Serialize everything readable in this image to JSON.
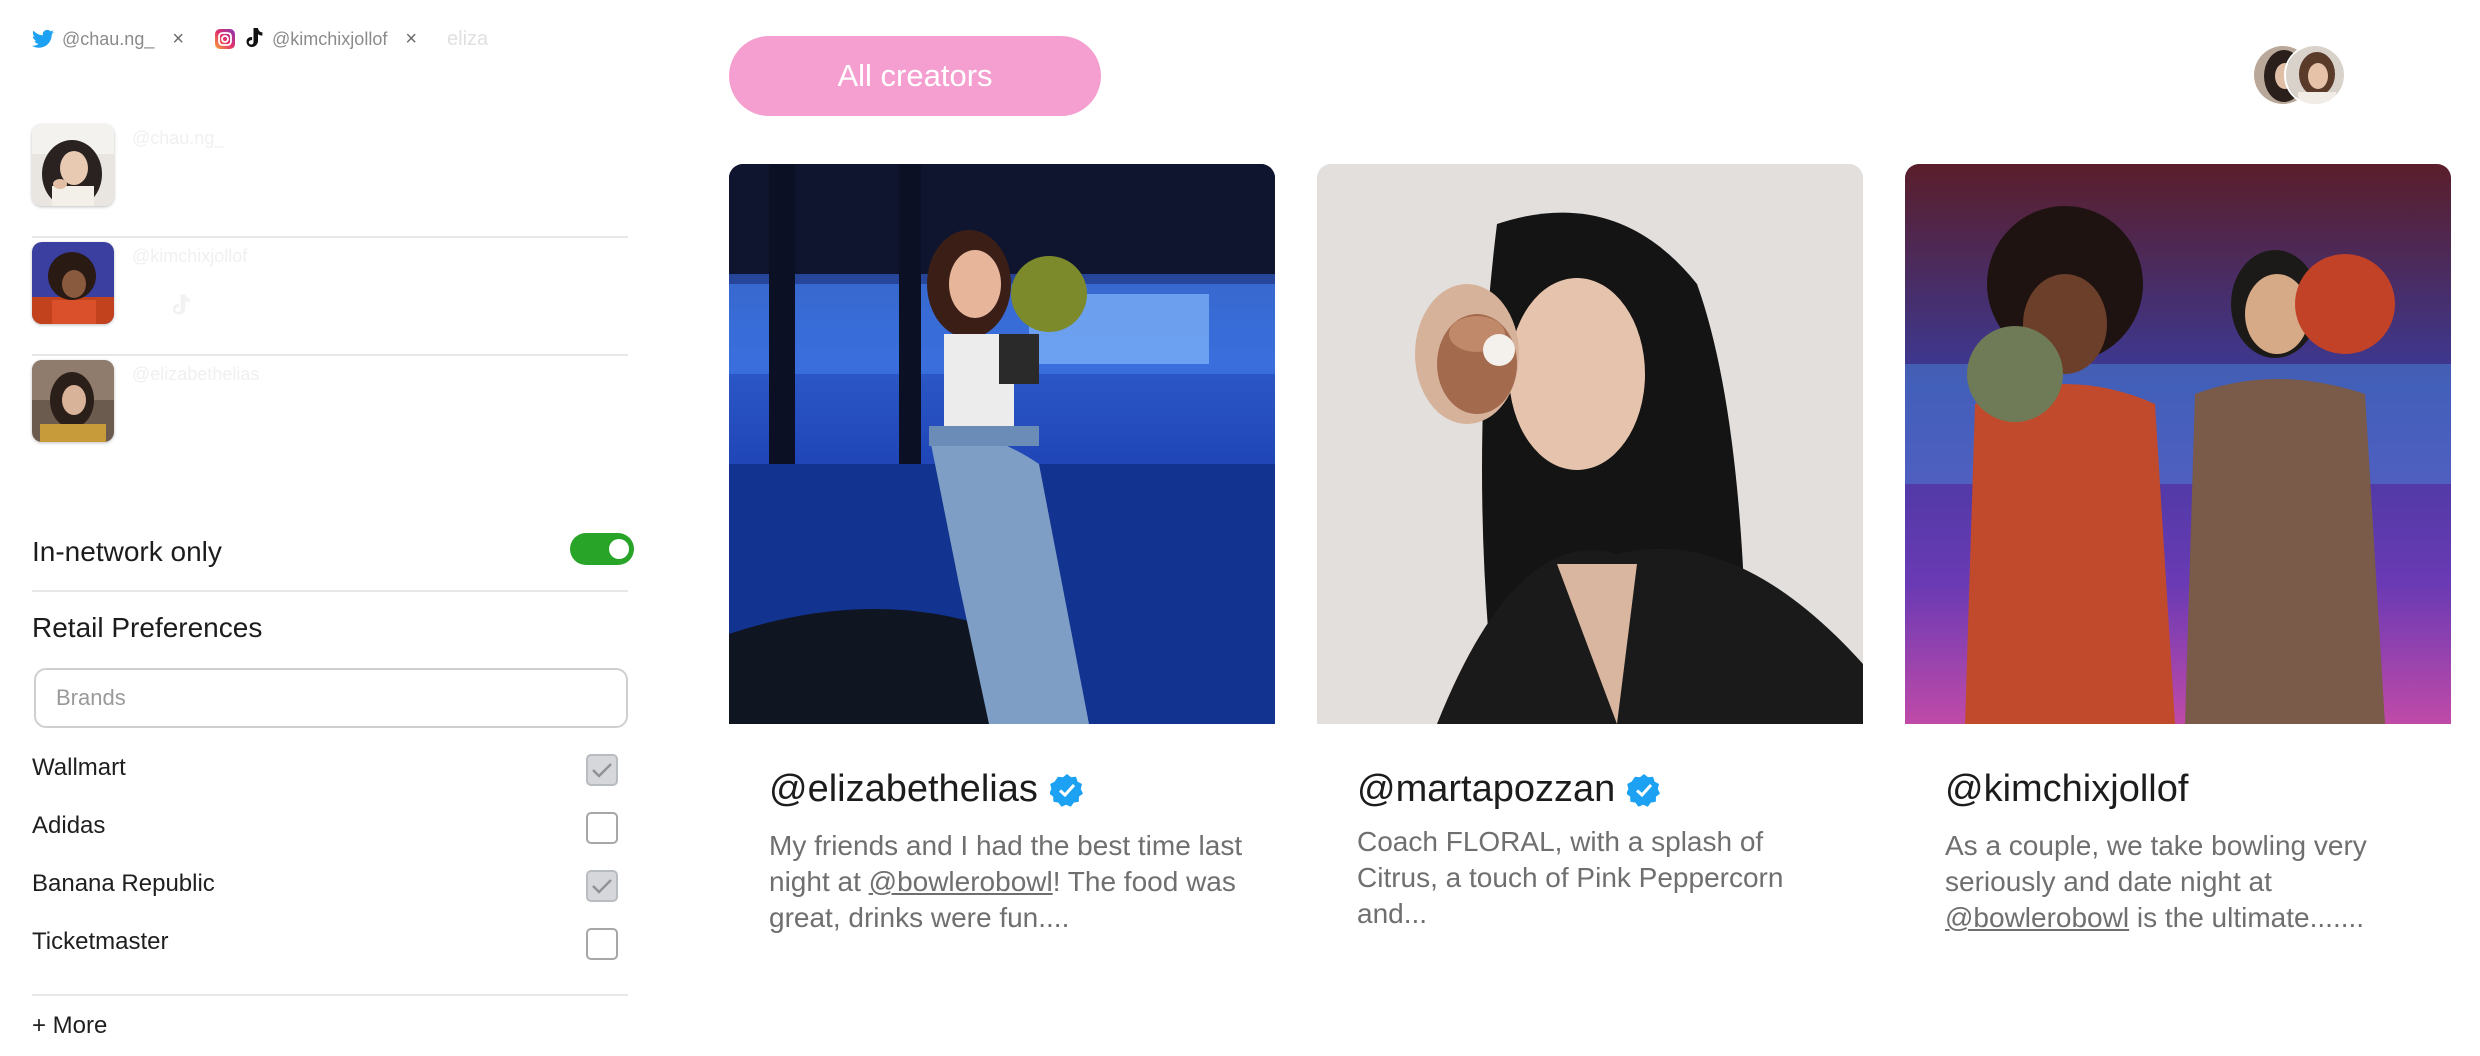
{
  "colors": {
    "accent_pink": "#f59fd1",
    "toggle_green": "#28a428",
    "verified_blue": "#1da1f2"
  },
  "filter_tags": [
    {
      "icon": "twitter-icon",
      "label": "@chau.ng_"
    },
    {
      "icon": "instagram-tiktok-icon",
      "label": "@kimchixjollof"
    }
  ],
  "tag_input_value": "eliza",
  "sidebar": {
    "creators": [
      {
        "name": "@chau.ng_"
      },
      {
        "name": "@kimchixjollof"
      },
      {
        "name": "@elizabethelias"
      }
    ],
    "in_network_label": "In-network only",
    "in_network_on": true,
    "retail_title": "Retail Preferences",
    "brands_placeholder": "Brands",
    "brands": [
      {
        "name": "Wallmart",
        "checked": true
      },
      {
        "name": "Adidas",
        "checked": false
      },
      {
        "name": "Banana Republic",
        "checked": true
      },
      {
        "name": "Ticketmaster",
        "checked": false
      }
    ],
    "more_label": "+ More"
  },
  "main": {
    "all_creators_label": "All creators",
    "cards": [
      {
        "handle": "@elizabethelias",
        "verified": true,
        "desc_pre": "My friends and I had the best time last night at ",
        "mention": "@bowlerobowl",
        "desc_post": "! The food was great, drinks were fun...."
      },
      {
        "handle": "@martapozzan",
        "verified": true,
        "desc_pre": "Coach FLORAL, with a splash of Citrus, a touch of Pink Peppercorn and...",
        "mention": "",
        "desc_post": ""
      },
      {
        "handle": "@kimchixjollof",
        "verified": false,
        "desc_pre": "As a couple, we take bowling very seriously and date night at ",
        "mention": "@bowlerobowl",
        "desc_post": " is the ultimate......."
      }
    ]
  }
}
